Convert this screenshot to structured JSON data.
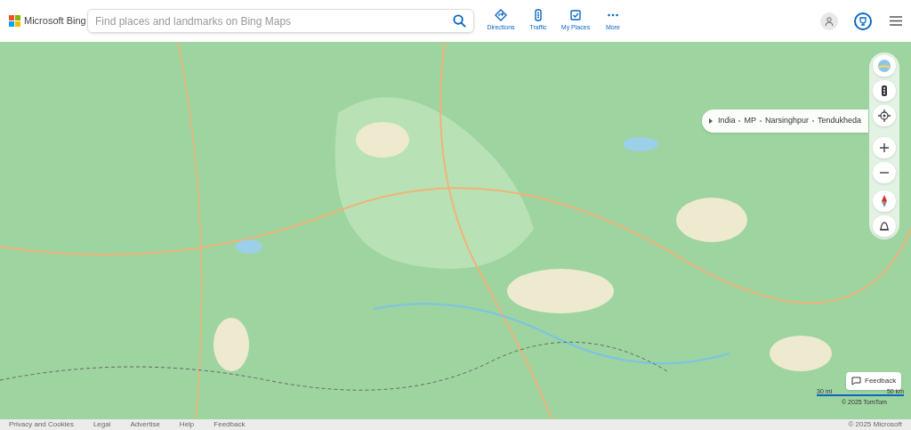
{
  "header": {
    "logo": "Microsoft Bing",
    "search": {
      "placeholder": "Find places and landmarks on Bing Maps"
    },
    "nav": [
      {
        "kind": "directions",
        "label": "Directions"
      },
      {
        "kind": "traffic",
        "label": "Traffic"
      },
      {
        "kind": "places",
        "label": "My Places"
      },
      {
        "kind": "more",
        "label": "More"
      }
    ]
  },
  "map": {
    "breadcrumb": [
      "India",
      "MP",
      "Narsinghpur",
      "Tendukheda"
    ],
    "controls": [
      {
        "kind": "style"
      },
      {
        "kind": "traffic"
      },
      {
        "kind": "locate"
      },
      {
        "kind": "zoom_in"
      },
      {
        "kind": "zoom_out"
      },
      {
        "kind": "compass"
      },
      {
        "kind": "bird"
      }
    ],
    "feedback": "Feedback",
    "scale": {
      "miles": "30 mi",
      "km": "50 km"
    },
    "attribution": "© 2025 TomTom"
  },
  "footer": {
    "links": [
      "Privacy and Cookies",
      "Legal",
      "Advertise",
      "Help",
      "Feedback"
    ],
    "copyright": "© 2025 Microsoft"
  }
}
